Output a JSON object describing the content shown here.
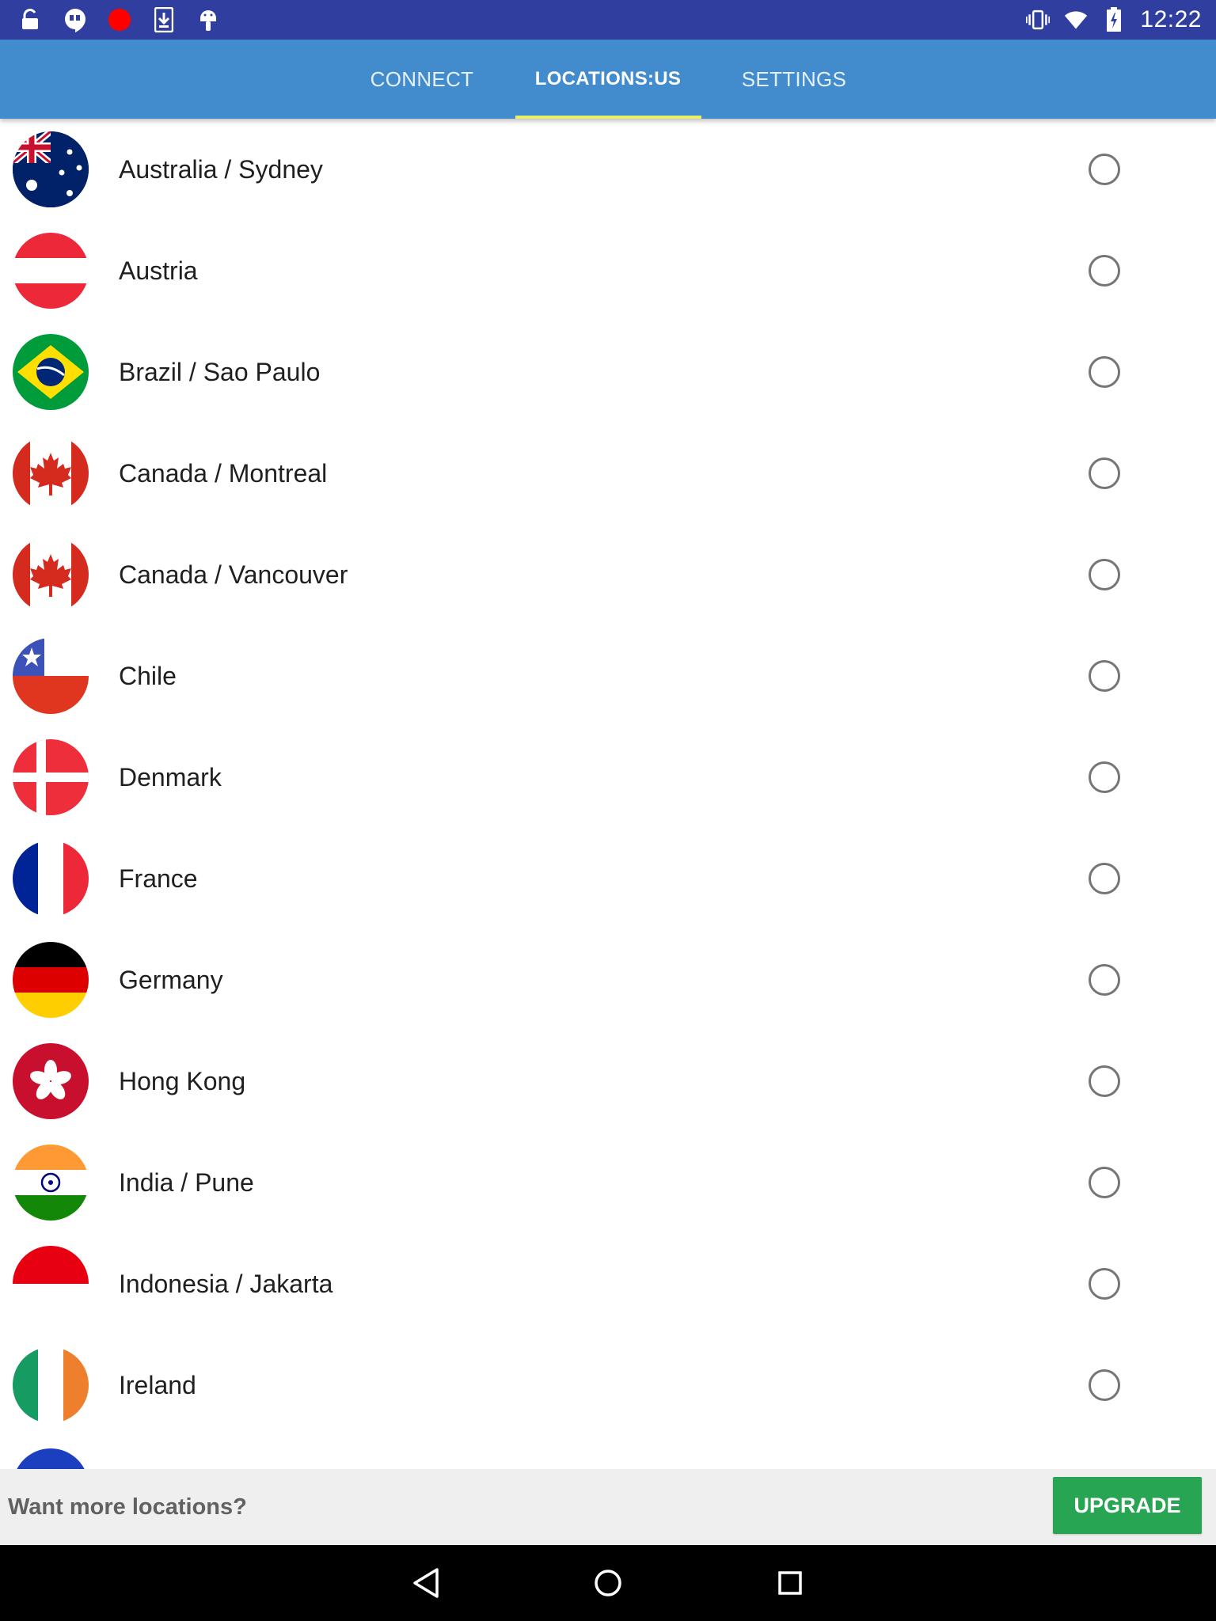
{
  "status_bar": {
    "time": "12:22",
    "left_icons": [
      "unlock-icon",
      "hangouts-icon",
      "record-icon",
      "download-icon",
      "android-icon"
    ],
    "right_icons": [
      "vibrate-icon",
      "wifi-icon",
      "battery-icon"
    ]
  },
  "tabs": [
    {
      "label": "CONNECT",
      "selected": false
    },
    {
      "label": "LOCATIONS:US",
      "selected": true
    },
    {
      "label": "SETTINGS",
      "selected": false
    }
  ],
  "locations": [
    {
      "label": "Australia / Sydney",
      "flag": "australia",
      "selected": false
    },
    {
      "label": "Austria",
      "flag": "austria",
      "selected": false
    },
    {
      "label": "Brazil / Sao Paulo",
      "flag": "brazil",
      "selected": false
    },
    {
      "label": "Canada / Montreal",
      "flag": "canada",
      "selected": false
    },
    {
      "label": "Canada / Vancouver",
      "flag": "canada",
      "selected": false
    },
    {
      "label": "Chile",
      "flag": "chile",
      "selected": false
    },
    {
      "label": "Denmark",
      "flag": "denmark",
      "selected": false
    },
    {
      "label": "France",
      "flag": "france",
      "selected": false
    },
    {
      "label": "Germany",
      "flag": "germany",
      "selected": false
    },
    {
      "label": "Hong Kong",
      "flag": "hong-kong",
      "selected": false
    },
    {
      "label": "India / Pune",
      "flag": "india",
      "selected": false
    },
    {
      "label": "Indonesia / Jakarta",
      "flag": "indonesia",
      "selected": false
    },
    {
      "label": "Ireland",
      "flag": "ireland",
      "selected": false
    }
  ],
  "bottom_bar": {
    "prompt": "Want more locations?",
    "upgrade_label": "UPGRADE"
  },
  "nav_bar": [
    "back-icon",
    "home-icon",
    "recents-icon"
  ],
  "colors": {
    "status_bar": "#303f9f",
    "app_bar": "#428bcc",
    "tab_indicator": "#e8f06a",
    "upgrade_button": "#28a552"
  }
}
